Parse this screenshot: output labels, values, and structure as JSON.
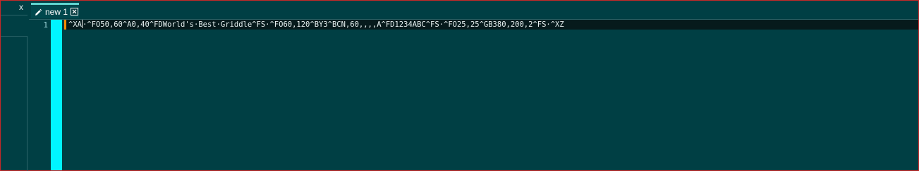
{
  "side_panel": {
    "close_label": "x"
  },
  "tabs": [
    {
      "label": "new 1",
      "icon": "pencil-icon",
      "active": true
    }
  ],
  "editor": {
    "line_numbers": [
      "1"
    ],
    "lines": [
      {
        "before_caret": "^XA",
        "after_caret": "·^FO50,60^A0,40^FDWorld's·Best·Griddle^FS·^FO60,120^BY3^BCN,60,,,,A^FD1234ABC^FS·^FO25,25^GB380,200,2^FS·^XZ"
      }
    ]
  },
  "colors": {
    "background": "#003f44",
    "margin": "#00f5ff",
    "change_marker": "#ff8a00",
    "current_line": "#061a1c",
    "tab_accent": "#5fd3cf",
    "border": "#c62828"
  }
}
